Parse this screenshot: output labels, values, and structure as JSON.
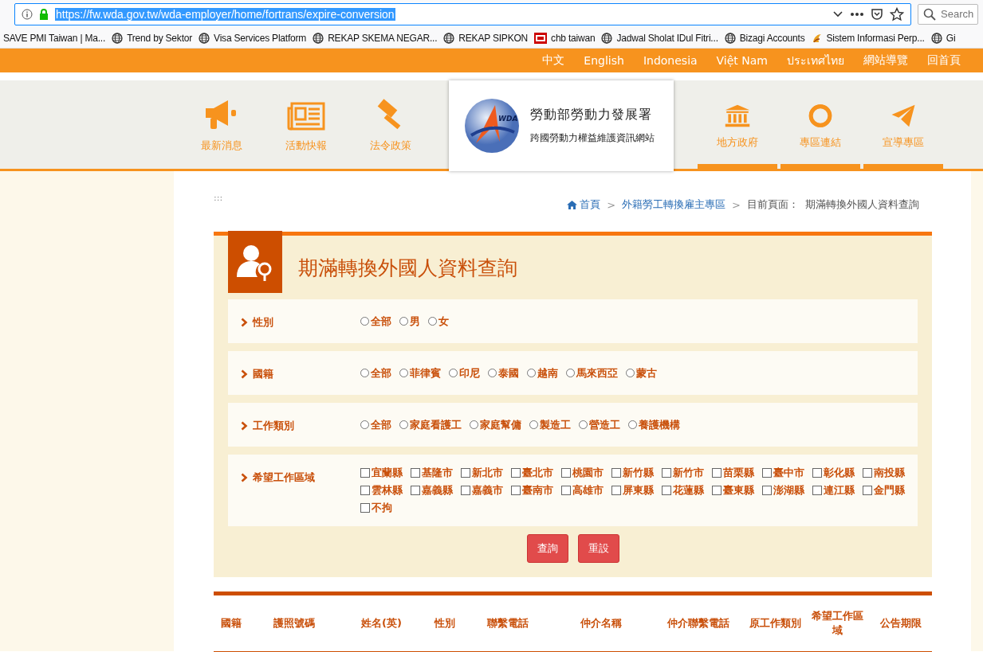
{
  "browser": {
    "url": "https://fw.wda.gov.tw/wda-employer/home/fortrans/expire-conversion",
    "search_placeholder": "Search",
    "bookmarks": [
      {
        "label": "SAVE PMI Taiwan | Ma...",
        "kind": "none"
      },
      {
        "label": "Trend by Sektor",
        "kind": "globe"
      },
      {
        "label": "Visa Services Platform",
        "kind": "globe"
      },
      {
        "label": "REKAP SKEMA NEGAR...",
        "kind": "globe"
      },
      {
        "label": "REKAP SIPKON",
        "kind": "globe"
      },
      {
        "label": "chb taiwan",
        "kind": "logo"
      },
      {
        "label": "Jadwal Sholat IDul Fitri...",
        "kind": "globe"
      },
      {
        "label": "Bizagi Accounts",
        "kind": "globe"
      },
      {
        "label": "Sistem Informasi Perp...",
        "kind": "swirl"
      },
      {
        "label": "Gi",
        "kind": "globe"
      }
    ]
  },
  "language_bar": [
    "中文",
    "English",
    "Indonesia",
    "Việt Nam",
    "ประเทศไทย",
    "網站導覽",
    "回首頁"
  ],
  "nav_left": [
    {
      "label": "最新消息"
    },
    {
      "label": "活動快報"
    },
    {
      "label": "法令政策"
    }
  ],
  "logo": {
    "title": "勞動部勞動力發展署",
    "subtitle": "跨國勞動力權益維護資訊網站",
    "mark": "WDA"
  },
  "nav_right": [
    {
      "label": "地方政府"
    },
    {
      "label": "專區連結"
    },
    {
      "label": "宣導專區"
    }
  ],
  "accesskey": ":::",
  "breadcrumb": {
    "separator": ">",
    "home": "首頁",
    "section": "外籍勞工轉換雇主專區",
    "current_label": "目前頁面：",
    "current": "期滿轉換外國人資料查詢"
  },
  "page_title": "期滿轉換外國人資料查詢",
  "filters": [
    {
      "label": "性別",
      "kind": "radio",
      "options": [
        {
          "label": "全部",
          "checked": false
        },
        {
          "label": "男",
          "checked": false
        },
        {
          "label": "女",
          "checked": false
        }
      ]
    },
    {
      "label": "國籍",
      "kind": "radio",
      "options": [
        {
          "label": "全部",
          "checked": false
        },
        {
          "label": "菲律賓",
          "checked": false
        },
        {
          "label": "印尼",
          "checked": false
        },
        {
          "label": "泰國",
          "checked": false
        },
        {
          "label": "越南",
          "checked": false
        },
        {
          "label": "馬來西亞",
          "checked": false
        },
        {
          "label": "蒙古",
          "checked": false
        }
      ]
    },
    {
      "label": "工作類別",
      "kind": "radio",
      "options": [
        {
          "label": "全部",
          "checked": false
        },
        {
          "label": "家庭看護工",
          "checked": false
        },
        {
          "label": "家庭幫傭",
          "checked": false
        },
        {
          "label": "製造工",
          "checked": false
        },
        {
          "label": "營造工",
          "checked": false
        },
        {
          "label": "養護機構",
          "checked": false
        }
      ]
    },
    {
      "label": "希望工作區域",
      "kind": "checkbox",
      "options": [
        {
          "label": "宜蘭縣",
          "checked": false
        },
        {
          "label": "基隆市",
          "checked": false
        },
        {
          "label": "新北市",
          "checked": false
        },
        {
          "label": "臺北市",
          "checked": false
        },
        {
          "label": "桃園市",
          "checked": false
        },
        {
          "label": "新竹縣",
          "checked": false
        },
        {
          "label": "新竹市",
          "checked": false
        },
        {
          "label": "苗栗縣",
          "checked": false
        },
        {
          "label": "臺中市",
          "checked": false
        },
        {
          "label": "彰化縣",
          "checked": false
        },
        {
          "label": "南投縣",
          "checked": false
        },
        {
          "label": "雲林縣",
          "checked": false
        },
        {
          "label": "嘉義縣",
          "checked": false
        },
        {
          "label": "嘉義市",
          "checked": false
        },
        {
          "label": "臺南市",
          "checked": false
        },
        {
          "label": "高雄市",
          "checked": false
        },
        {
          "label": "屏東縣",
          "checked": false
        },
        {
          "label": "花蓮縣",
          "checked": false
        },
        {
          "label": "臺東縣",
          "checked": false
        },
        {
          "label": "澎湖縣",
          "checked": false
        },
        {
          "label": "連江縣",
          "checked": false
        },
        {
          "label": "金門縣",
          "checked": false
        },
        {
          "label": "不拘",
          "checked": false
        }
      ]
    }
  ],
  "buttons": [
    "查詢",
    "重設"
  ],
  "table": {
    "columns": [
      "國籍",
      "護照號碼",
      "姓名(英)",
      "性別",
      "聯繫電話",
      "仲介名稱",
      "仲介聯繫電話",
      "原工作類別",
      "希望工作區域",
      "公告期限"
    ]
  }
}
